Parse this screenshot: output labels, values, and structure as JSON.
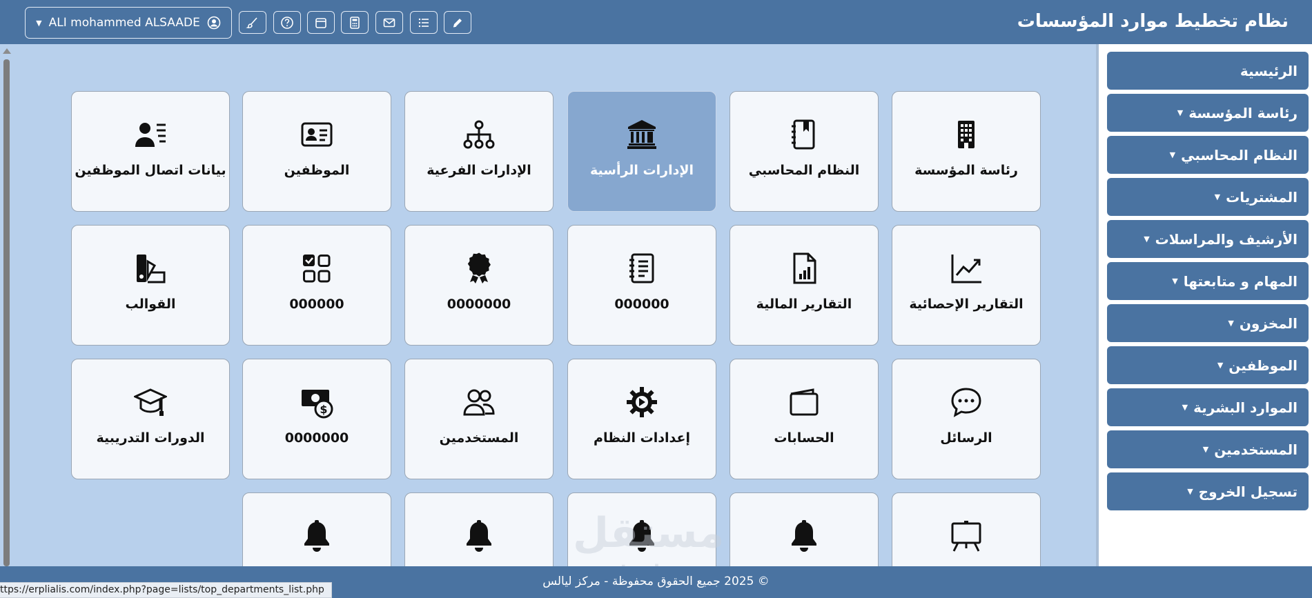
{
  "header": {
    "title": "نظام تخطيط موارد المؤسسات",
    "user_name": "ALI mohammed ALSAADE",
    "toolbar_icons": [
      "pencil-icon",
      "list-icon",
      "envelope-icon",
      "calculator-icon",
      "calendar-icon",
      "help-icon",
      "brush-icon"
    ]
  },
  "tiles": [
    {
      "label": "رئاسة المؤسسة",
      "icon": "building-icon"
    },
    {
      "label": "النظام المحاسبي",
      "icon": "ledger-book-icon"
    },
    {
      "label": "الإدارات الرأسية",
      "icon": "institution-icon",
      "active": true
    },
    {
      "label": "الإدارات الفرعية",
      "icon": "org-chart-icon"
    },
    {
      "label": "الموظفين",
      "icon": "id-card-icon"
    },
    {
      "label": "بيانات اتصال الموظفين",
      "icon": "contact-list-icon"
    },
    {
      "label": "التقارير الإحصائية",
      "icon": "line-chart-icon"
    },
    {
      "label": "التقارير المالية",
      "icon": "report-file-icon"
    },
    {
      "label": "000000",
      "icon": "notebook-icon"
    },
    {
      "label": "0000000",
      "icon": "award-badge-icon"
    },
    {
      "label": "000000",
      "icon": "checkbox-grid-icon"
    },
    {
      "label": "القوالب",
      "icon": "swatches-icon"
    },
    {
      "label": "الرسائل",
      "icon": "chat-bubble-icon"
    },
    {
      "label": "الحسابات",
      "icon": "wallet-icon"
    },
    {
      "label": "إعدادات النظام",
      "icon": "gear-icon"
    },
    {
      "label": "المستخدمين",
      "icon": "users-icon"
    },
    {
      "label": "0000000",
      "icon": "cash-icon"
    },
    {
      "label": "الدورات التدريبية",
      "icon": "graduation-cap-icon"
    },
    {
      "label": "",
      "icon": "easel-board-icon"
    },
    {
      "label": "",
      "icon": "bell-icon"
    },
    {
      "label": "",
      "icon": "bell-icon"
    },
    {
      "label": "",
      "icon": "bell-icon"
    },
    {
      "label": "",
      "icon": "bell-icon"
    }
  ],
  "sidebar": {
    "items": [
      {
        "label": "الرئيسية",
        "has_caret": false
      },
      {
        "label": "رئاسة المؤسسة",
        "has_caret": true
      },
      {
        "label": "النظام المحاسبي",
        "has_caret": true
      },
      {
        "label": "المشتريات",
        "has_caret": true
      },
      {
        "label": "الأرشيف والمراسلات",
        "has_caret": true
      },
      {
        "label": "المهام و متابعتها",
        "has_caret": true
      },
      {
        "label": "المخزون",
        "has_caret": true
      },
      {
        "label": "الموظفين",
        "has_caret": true
      },
      {
        "label": "الموارد البشرية",
        "has_caret": true
      },
      {
        "label": "المستخدمين",
        "has_caret": true
      },
      {
        "label": "تسجيل الخروج",
        "has_caret": true
      }
    ]
  },
  "footer": {
    "copyright": "© 2025 جميع الحقوق محفوظة - مركز ليالس",
    "status_url": "ttps://erplialis.com/index.php?page=lists/top_departments_list.php"
  },
  "watermark": {
    "text": "مستقل",
    "subtext": "mostaql.com"
  },
  "colors": {
    "primary": "#4a73a1",
    "background": "#b8d0ec",
    "tile": "#f4f7fb",
    "tile_active": "#86a7cf"
  }
}
